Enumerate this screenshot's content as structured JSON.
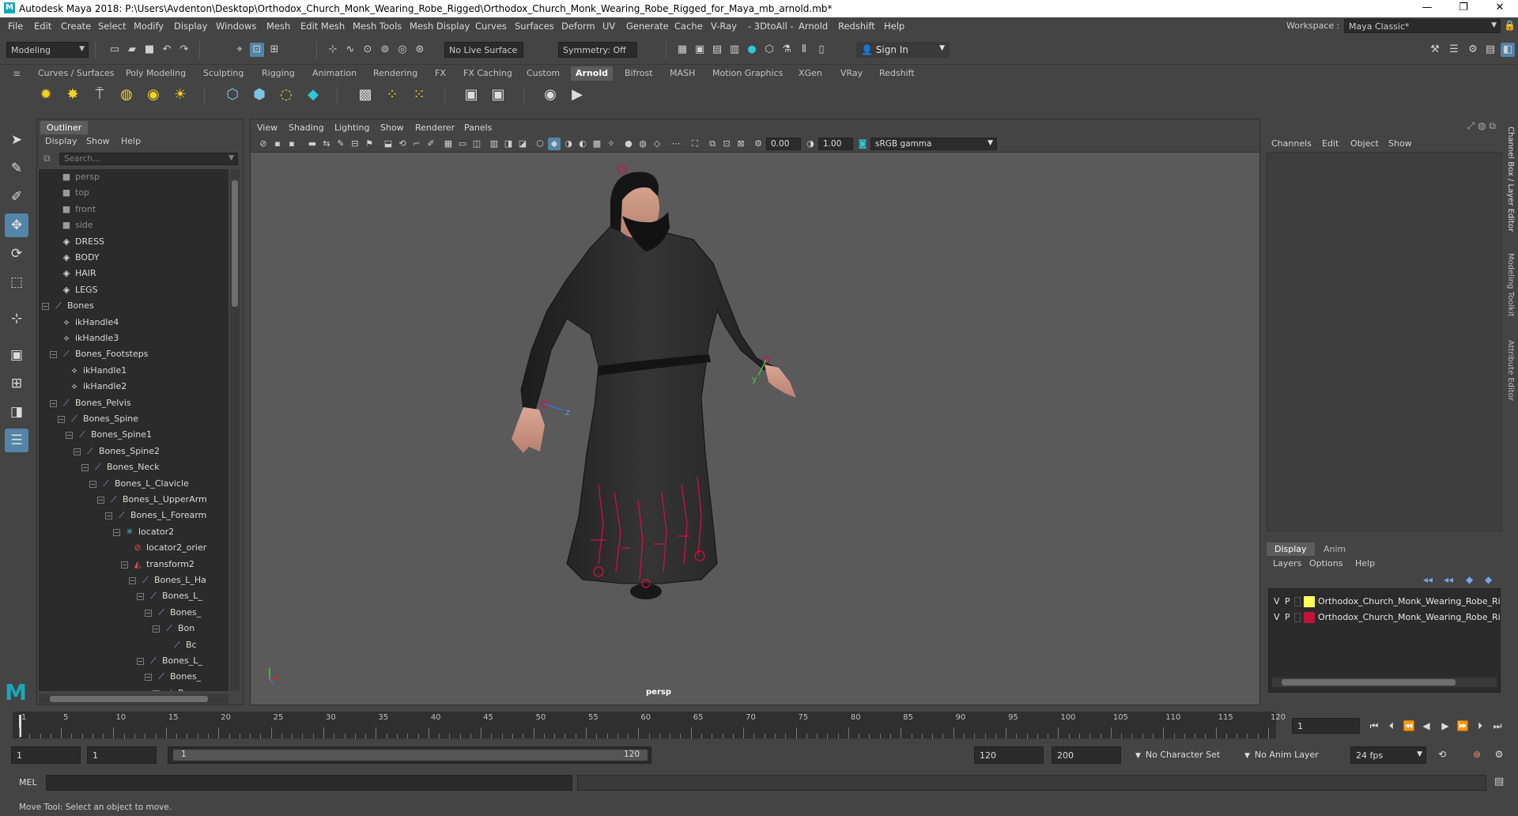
{
  "window": {
    "title": "Autodesk Maya 2018: P:\\Users\\Avdenton\\Desktop\\Orthodox_Church_Monk_Wearing_Robe_Rigged\\Orthodox_Church_Monk_Wearing_Robe_Rigged_for_Maya_mb_arnold.mb*",
    "minimize": "—",
    "maximize": "❐",
    "close": "✕"
  },
  "menubar": {
    "items": [
      "File",
      "Edit",
      "Create",
      "Select",
      "Modify",
      "Display",
      "Windows",
      "Mesh",
      "Edit Mesh",
      "Mesh Tools",
      "Mesh Display",
      "Curves",
      "Surfaces",
      "Deform",
      "UV",
      "Generate",
      "Cache",
      "V-Ray",
      "- 3DtoAll -",
      "Arnold",
      "Redshift",
      "Help"
    ],
    "workspace_label": "Workspace :",
    "workspace_value": "Maya Classic*"
  },
  "statusline": {
    "mode": "Modeling",
    "live_surface": "No Live Surface",
    "symmetry": "Symmetry: Off",
    "sign_in": "Sign In"
  },
  "shelf": {
    "tabs": [
      "Curves / Surfaces",
      "Poly Modeling",
      "Sculpting",
      "Rigging",
      "Animation",
      "Rendering",
      "FX",
      "FX Caching",
      "Custom",
      "Arnold",
      "Bifrost",
      "MASH",
      "Motion Graphics",
      "XGen",
      "VRay",
      "Redshift"
    ],
    "active_tab": "Arnold"
  },
  "outliner": {
    "tab": "Outliner",
    "menu": [
      "Display",
      "Show",
      "Help"
    ],
    "search_placeholder": "Search...",
    "items": [
      {
        "label": "persp",
        "icon": "camera-icon",
        "dim": true
      },
      {
        "label": "top",
        "icon": "camera-icon",
        "dim": true
      },
      {
        "label": "front",
        "icon": "camera-icon",
        "dim": true
      },
      {
        "label": "side",
        "icon": "camera-icon",
        "dim": true
      },
      {
        "label": "DRESS",
        "icon": "mesh-icon"
      },
      {
        "label": "BODY",
        "icon": "mesh-icon"
      },
      {
        "label": "HAIR",
        "icon": "mesh-icon"
      },
      {
        "label": "LEGS",
        "icon": "mesh-icon"
      },
      {
        "label": "Bones",
        "icon": "joint-icon"
      },
      {
        "label": "ikHandle4",
        "icon": "ik-handle-icon"
      },
      {
        "label": "ikHandle3",
        "icon": "ik-handle-icon"
      },
      {
        "label": "Bones_Footsteps",
        "icon": "joint-icon"
      },
      {
        "label": "ikHandle1",
        "icon": "ik-handle-icon"
      },
      {
        "label": "ikHandle2",
        "icon": "ik-handle-icon"
      },
      {
        "label": "Bones_Pelvis",
        "icon": "joint-icon"
      },
      {
        "label": "Bones_Spine",
        "icon": "joint-icon"
      },
      {
        "label": "Bones_Spine1",
        "icon": "joint-icon"
      },
      {
        "label": "Bones_Spine2",
        "icon": "joint-icon"
      },
      {
        "label": "Bones_Neck",
        "icon": "joint-icon"
      },
      {
        "label": "Bones_L_Clavicle",
        "icon": "joint-icon"
      },
      {
        "label": "Bones_L_UpperArm",
        "icon": "joint-icon"
      },
      {
        "label": "Bones_L_Forearm",
        "icon": "joint-icon"
      },
      {
        "label": "locator2",
        "icon": "locator-icon"
      },
      {
        "label": "locator2_orier",
        "icon": "constraint-icon"
      },
      {
        "label": "transform2",
        "icon": "transform-icon"
      },
      {
        "label": "Bones_L_Ha",
        "icon": "joint-icon"
      },
      {
        "label": "Bones_L_",
        "icon": "joint-icon"
      },
      {
        "label": "Bones_",
        "icon": "joint-icon"
      },
      {
        "label": "Bon",
        "icon": "joint-icon"
      },
      {
        "label": "Bc",
        "icon": "joint-icon"
      },
      {
        "label": "Bones_L_",
        "icon": "joint-icon"
      },
      {
        "label": "Bones_",
        "icon": "joint-icon"
      },
      {
        "label": "Bon",
        "icon": "joint-icon"
      }
    ]
  },
  "viewport": {
    "menu": [
      "View",
      "Shading",
      "Lighting",
      "Show",
      "Renderer",
      "Panels"
    ],
    "exposure": "0.00",
    "gamma": "1.00",
    "color_space": "sRGB gamma",
    "camera": "persp",
    "axis_y": "y",
    "axis_z": "z"
  },
  "channelbox": {
    "menu": [
      "Channels",
      "Edit",
      "Object",
      "Show"
    ],
    "layer_tabs": [
      "Display",
      "Anim"
    ],
    "layer_menu": [
      "Layers",
      "Options",
      "Help"
    ],
    "layers": [
      {
        "v": "V",
        "p": "P",
        "color": "#ffff55",
        "name": "Orthodox_Church_Monk_Wearing_Robe_Rigg"
      },
      {
        "v": "V",
        "p": "P",
        "color": "#c0143c",
        "name": "Orthodox_Church_Monk_Wearing_Robe_Rig"
      }
    ],
    "side_tabs": [
      "Channel Box / Layer Editor",
      "Modeling Toolkit",
      "Attribute Editor"
    ]
  },
  "timeline": {
    "ticks": [
      "1",
      "5",
      "10",
      "15",
      "20",
      "25",
      "30",
      "35",
      "40",
      "45",
      "50",
      "55",
      "60",
      "65",
      "70",
      "75",
      "80",
      "85",
      "90",
      "95",
      "100",
      "105",
      "110",
      "115",
      "120"
    ],
    "current_frame": "1"
  },
  "range": {
    "start": "1",
    "inner_start": "1",
    "slider_start": "1",
    "slider_end": "120",
    "end": "120",
    "anim_end": "200",
    "character_set": "No Character Set",
    "anim_layer": "No Anim Layer",
    "fps": "24 fps"
  },
  "cmdline": {
    "label": "MEL"
  },
  "helpline": {
    "text": "Move Tool: Select an object to move."
  }
}
